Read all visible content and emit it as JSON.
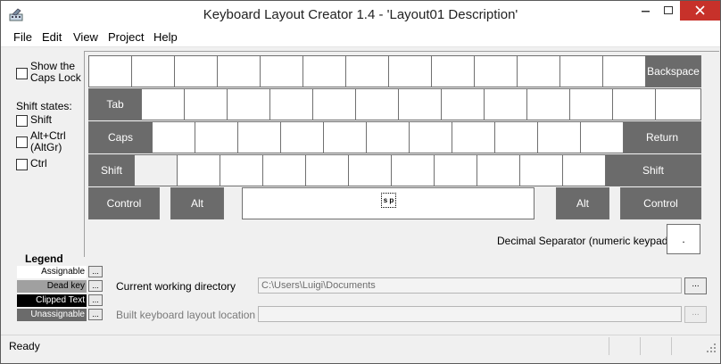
{
  "window": {
    "title": "Keyboard Layout Creator 1.4 - 'Layout01 Description'"
  },
  "menu": [
    "File",
    "Edit",
    "View",
    "Project",
    "Help"
  ],
  "options": {
    "show_caps_lock_line1": "Show the",
    "show_caps_lock_line2": "Caps Lock",
    "shift_states_title": "Shift states:",
    "shift": "Shift",
    "altgr_line1": "Alt+Ctrl",
    "altgr_line2": "(AltGr)",
    "ctrl": "Ctrl"
  },
  "keys": {
    "backspace": "Backspace",
    "tab": "Tab",
    "caps": "Caps",
    "return": "Return",
    "shift_left": "Shift",
    "shift_right": "Shift",
    "control_left": "Control",
    "alt_left": "Alt",
    "space": "s p",
    "alt_right": "Alt",
    "control_right": "Control"
  },
  "decimal": {
    "label": "Decimal Separator (numeric keypad)",
    "value": "."
  },
  "legend": {
    "title": "Legend",
    "items": [
      {
        "label": "Assignable",
        "bg": "#ffffff",
        "fg": "#000000"
      },
      {
        "label": "Dead key",
        "bg": "#a0a0a0",
        "fg": "#000000"
      },
      {
        "label": "Clipped Text",
        "bg": "#000000",
        "fg": "#ffffff"
      },
      {
        "label": "Unassignable",
        "bg": "#6b6b6b",
        "fg": "#ffffff"
      }
    ],
    "button_label": "..."
  },
  "paths": {
    "working_dir_label": "Current working directory",
    "working_dir_value": "C:\\Users\\Luigi\\Documents",
    "build_location_label": "Built keyboard layout location",
    "build_location_value": "",
    "browse_label": "..."
  },
  "status": {
    "text": "Ready"
  },
  "colors": {
    "close_button": "#c7312a",
    "dark_key": "#6b6b6b",
    "light_key": "#ffffff"
  }
}
